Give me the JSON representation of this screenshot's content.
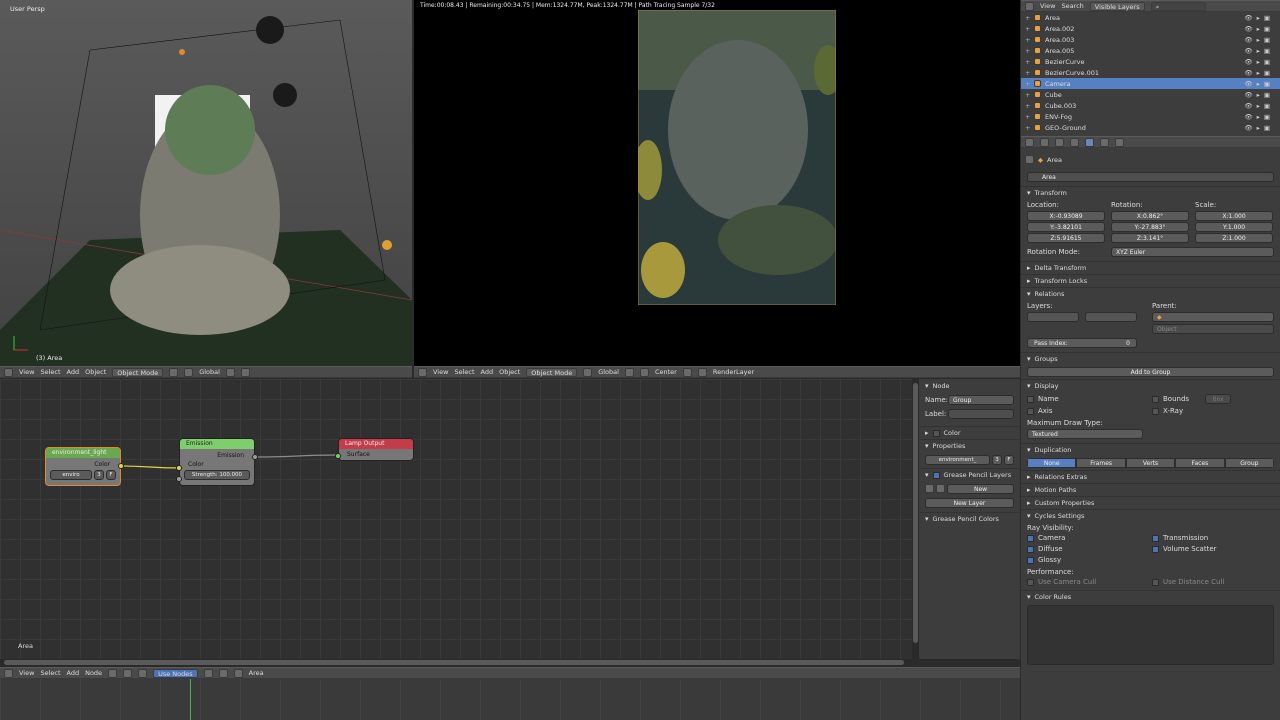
{
  "viewport3d": {
    "label": "User Persp",
    "object_label": "(3) Area",
    "header": {
      "menus": [
        "View",
        "Select",
        "Add",
        "Object"
      ],
      "mode": "Object Mode",
      "orientation": "Global"
    }
  },
  "render": {
    "status": "Time:00:08.43 | Remaining:00:34.75 | Mem:1324.77M, Peak:1324.77M | Path Tracing Sample 7/32",
    "header": {
      "menus": [
        "View",
        "Select",
        "Add",
        "Object"
      ],
      "mode": "Object Mode",
      "orientation": "Global",
      "pivot": "Center",
      "layer": "RenderLayer"
    }
  },
  "outliner": {
    "header": {
      "menus": [
        "View",
        "Search"
      ],
      "filter": "Visible Layers"
    },
    "items": [
      {
        "name": "Area",
        "selected": false
      },
      {
        "name": "Area.002",
        "selected": false
      },
      {
        "name": "Area.003",
        "selected": false
      },
      {
        "name": "Area.005",
        "selected": false
      },
      {
        "name": "BezierCurve",
        "selected": false
      },
      {
        "name": "BezierCurve.001",
        "selected": false
      },
      {
        "name": "Camera",
        "selected": true
      },
      {
        "name": "Cube",
        "selected": false
      },
      {
        "name": "Cube.003",
        "selected": false
      },
      {
        "name": "ENV-Fog",
        "selected": false
      },
      {
        "name": "GEO-Ground",
        "selected": false
      }
    ]
  },
  "properties": {
    "breadcrumb": "Area",
    "object_name": "Area",
    "transform": {
      "title": "Transform",
      "location_label": "Location:",
      "rotation_label": "Rotation:",
      "scale_label": "Scale:",
      "location": {
        "x": "-0.93089",
        "y": "-3.82101",
        "z": "5.91615"
      },
      "rotation": {
        "x": "0.862°",
        "y": "-27.883°",
        "z": "3.141°"
      },
      "scale": {
        "x": "1.000",
        "y": "1.000",
        "z": "1.000"
      },
      "rotation_mode_label": "Rotation Mode:",
      "rotation_mode": "XYZ Euler"
    },
    "delta_transform": "Delta Transform",
    "transform_locks": "Transform Locks",
    "relations": {
      "title": "Relations",
      "layers_label": "Layers:",
      "parent_label": "Parent:",
      "parent_type": "Object",
      "pass_index_label": "Pass Index:",
      "pass_index": "0"
    },
    "groups": {
      "title": "Groups",
      "add_button": "Add to Group"
    },
    "display": {
      "title": "Display",
      "name": "Name",
      "axis": "Axis",
      "bounds": "Bounds",
      "bounds_type": "Box",
      "xray": "X-Ray",
      "max_draw_label": "Maximum Draw Type:",
      "max_draw": "Textured"
    },
    "duplication": {
      "title": "Duplication",
      "options": [
        "None",
        "Frames",
        "Verts",
        "Faces",
        "Group"
      ]
    },
    "relations_extras": "Relations Extras",
    "motion_paths": "Motion Paths",
    "custom_properties": "Custom Properties",
    "cycles": {
      "title": "Cycles Settings",
      "ray_visibility": "Ray Visibility:",
      "camera": "Camera",
      "diffuse": "Diffuse",
      "glossy": "Glossy",
      "transmission": "Transmission",
      "volume_scatter": "Volume Scatter",
      "performance": "Performance:",
      "use_camera_cull": "Use Camera Cull",
      "use_distance_cull": "Use Distance Cull"
    },
    "color_rules": "Color Rules"
  },
  "node_editor": {
    "label": "Area",
    "header": {
      "menus": [
        "View",
        "Select",
        "Add",
        "Node"
      ],
      "use_nodes": "Use Nodes",
      "node_tree": "Area"
    },
    "nodes": {
      "group": {
        "title": "environment_light",
        "output": "Color",
        "field": "enviro",
        "users": "3",
        "fake": "F"
      },
      "emission": {
        "title": "Emission",
        "output": "Emission",
        "input_color": "Color",
        "strength": "Strength: 100.000"
      },
      "lamp_output": {
        "title": "Lamp Output",
        "input": "Surface"
      }
    },
    "sidebar": {
      "node_title": "Node",
      "name_label": "Name:",
      "name": "Group",
      "label_label": "Label:",
      "color": "Color",
      "properties": "Properties",
      "group_field": "environment_",
      "group_users": "3",
      "group_fake": "F",
      "gp_layers": "Grease Pencil Layers",
      "new": "New",
      "new_layer": "New Layer",
      "gp_colors": "Grease Pencil Colors"
    }
  },
  "colors": {
    "selection": "#5680c2",
    "group_node_header": "#6aa84f",
    "emission_node_header": "#7ccf6a",
    "lamp_output_header": "#c43c4a"
  }
}
